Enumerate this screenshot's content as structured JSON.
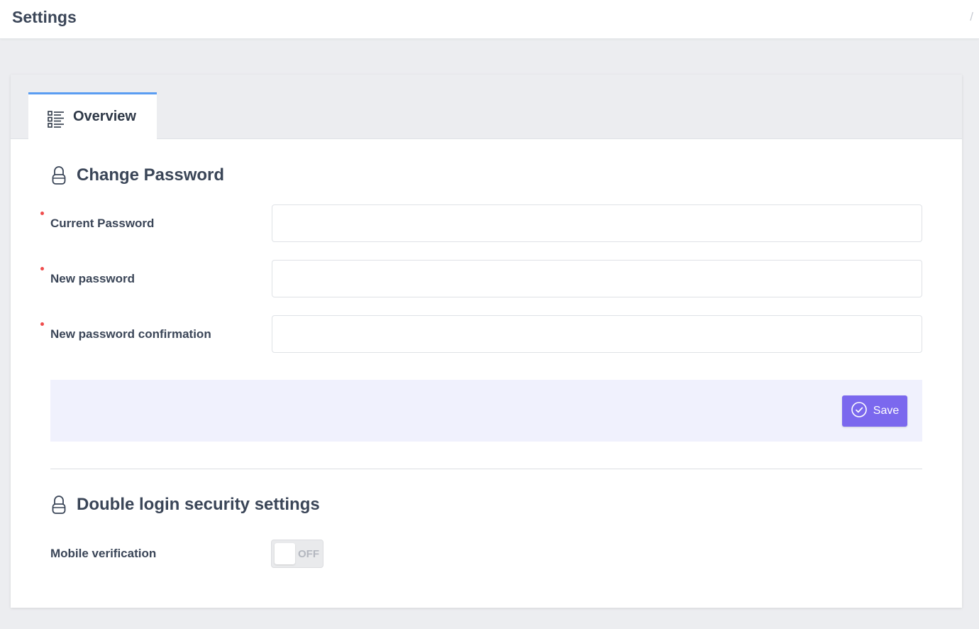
{
  "header": {
    "title": "Settings",
    "breadcrumb_separator": "/"
  },
  "tabs": [
    {
      "label": "Overview",
      "icon": "list-icon",
      "active": true
    }
  ],
  "change_password": {
    "title": "Change Password",
    "icon": "lock-icon",
    "fields": [
      {
        "label": "Current Password",
        "required": true,
        "value": "",
        "placeholder": ""
      },
      {
        "label": "New password",
        "required": true,
        "value": "",
        "placeholder": ""
      },
      {
        "label": "New password confirmation",
        "required": true,
        "value": "",
        "placeholder": ""
      }
    ],
    "save_label": "Save",
    "save_icon": "check-circle-icon"
  },
  "double_login": {
    "title": "Double login security settings",
    "icon": "lock-icon",
    "mobile_verification": {
      "label": "Mobile verification",
      "state_label": "OFF",
      "enabled": false
    }
  },
  "colors": {
    "accent": "#7b68ee",
    "tab_indicator": "#5a9df2",
    "required": "#ef4d4d",
    "action_bar": "#f0f1fd"
  }
}
